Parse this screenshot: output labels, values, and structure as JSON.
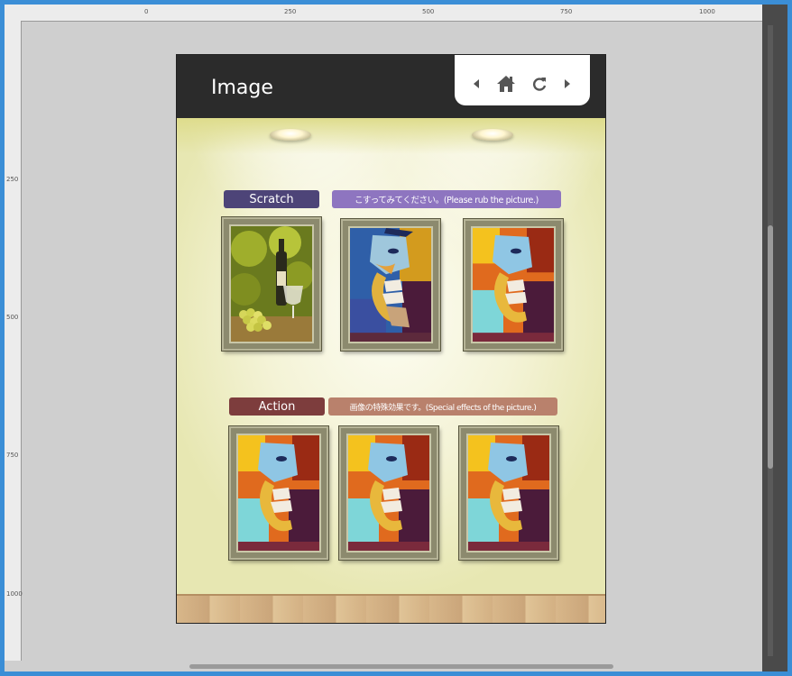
{
  "app": {
    "title": "Image",
    "nav": {
      "prev_icon": "triangle-left-icon",
      "home_icon": "home-icon",
      "refresh_icon": "refresh-icon",
      "next_icon": "triangle-right-icon"
    }
  },
  "ruler": {
    "top_ticks": [
      "0",
      "250",
      "500",
      "750",
      "1000"
    ],
    "left_ticks": [
      "250",
      "500",
      "750",
      "1000"
    ]
  },
  "sections": {
    "scratch": {
      "label": "Scratch",
      "description": "こすってみてください。(Please rub the picture.)",
      "label_color": "#4d4478",
      "description_color": "#8e75c0"
    },
    "action": {
      "label": "Action",
      "description": "画像の特殊効果です。(Special effects of the picture.)",
      "label_color": "#7d3d3d",
      "description_color": "#b9816c"
    }
  },
  "pictures": {
    "scratch": [
      "wine-still-life",
      "saxophone-player-painting",
      "saxophone-player-painting"
    ],
    "action": [
      "saxophone-player-painting",
      "saxophone-player-painting",
      "saxophone-player-painting"
    ]
  },
  "colors": {
    "header": "#2b2b2b",
    "window_border": "#3b8ed6",
    "frame_gold": "#8c8a6e"
  }
}
